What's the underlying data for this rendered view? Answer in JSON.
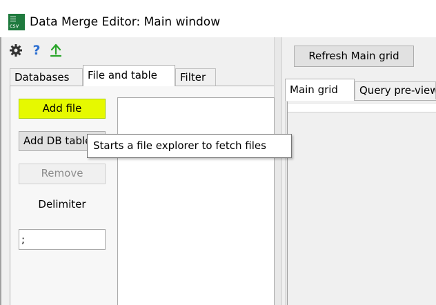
{
  "window": {
    "title": "Data Merge Editor: Main window",
    "icon_text": "csv"
  },
  "toolbar": {
    "help_glyph": "?"
  },
  "left_tabs": [
    {
      "label": "Databases"
    },
    {
      "label": "File and table"
    },
    {
      "label": "Filter"
    }
  ],
  "file_tab": {
    "add_file_label": "Add file",
    "add_db_table_label": "Add DB table",
    "remove_label": "Remove",
    "delimiter_label": "Delimiter",
    "delimiter_value": ";"
  },
  "tooltip": {
    "text": "Starts a file explorer to fetch files"
  },
  "right": {
    "refresh_label": "Refresh Main grid",
    "tabs": [
      {
        "label": "Main grid"
      },
      {
        "label": "Query pre-view"
      }
    ]
  },
  "colors": {
    "highlight": "#e6f900",
    "icon_green": "#1f7a3e",
    "help_blue": "#2c6fd1"
  }
}
